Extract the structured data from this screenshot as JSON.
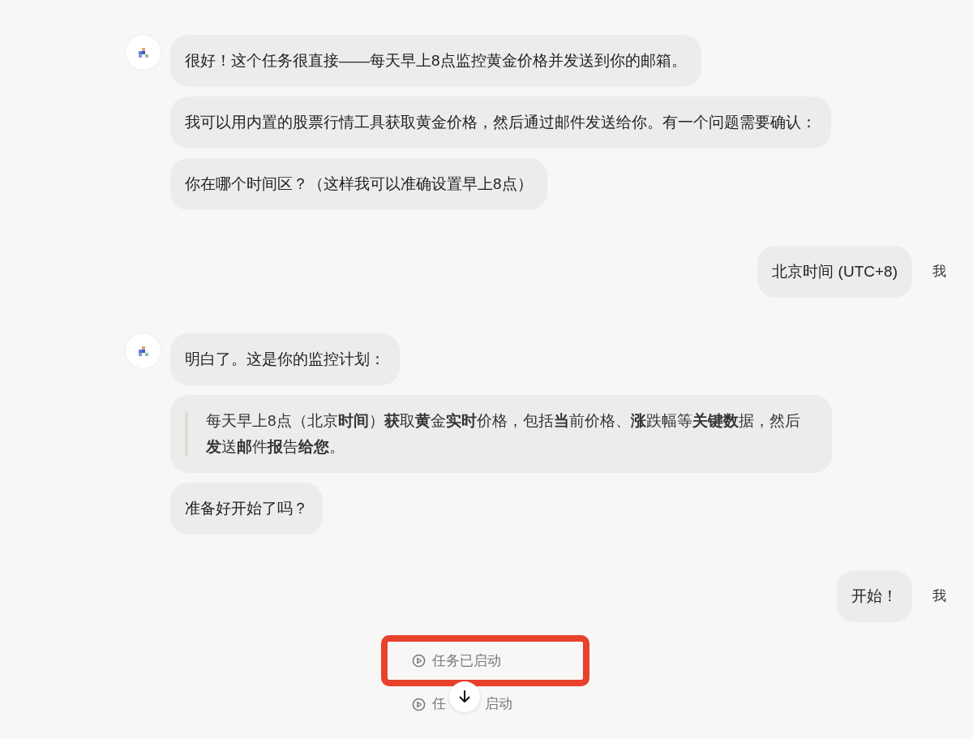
{
  "messages": [
    {
      "kind": "assistant",
      "bubbles": [
        {
          "kind": "text",
          "text": "很好！这个任务很直接——每天早上8点监控黄金价格并发送到你的邮箱。"
        },
        {
          "kind": "text",
          "text": "我可以用内置的股票行情工具获取黄金价格，然后通过邮件发送给你。有一个问题需要确认："
        },
        {
          "kind": "text",
          "text": "你在哪个时间区？（这样我可以准确设置早上8点）"
        }
      ]
    },
    {
      "kind": "user",
      "text": "北京时间 (UTC+8)",
      "sender": "我"
    },
    {
      "kind": "assistant",
      "bubbles": [
        {
          "kind": "text",
          "text": "明白了。这是你的监控计划："
        },
        {
          "kind": "quote",
          "text": "每天早上8点（北京**时间**）**获**取**黄**金**实时**价格，包括**当**前价格、**涨**跌幅等**关键数**据，然后**发**送**邮**件**报**告**给您**。"
        },
        {
          "kind": "text",
          "text": "准备好开始了吗？"
        }
      ]
    },
    {
      "kind": "user",
      "text": "开始！",
      "sender": "我"
    }
  ],
  "status": [
    {
      "parts": [
        "任务已启动"
      ],
      "highlighted": true
    },
    {
      "parts": [
        "任",
        "启动"
      ],
      "highlighted": false
    }
  ]
}
